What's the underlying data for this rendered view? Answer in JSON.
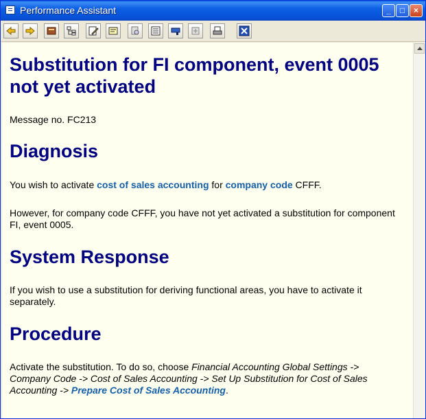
{
  "window": {
    "title": "Performance Assistant"
  },
  "toolbar": {
    "buttons": [
      "back-icon",
      "forward-icon",
      "book-icon",
      "structure-icon",
      "edit-icon",
      "hint-icon",
      "print-preview-icon",
      "document-icon",
      "flag-icon",
      "settings-icon",
      "printer-icon",
      "close-icon"
    ]
  },
  "doc": {
    "title_line1": "Substitution for FI component, event 0005",
    "title_line2": "not yet activated",
    "message_no": "Message no. FC213",
    "diagnosis_heading": "Diagnosis",
    "diag_p1_a": "You wish to activate ",
    "diag_p1_link1": "cost of sales accounting",
    "diag_p1_b": " for ",
    "diag_p1_link2": "company code",
    "diag_p1_c": " CFFF.",
    "diag_p2": "However, for company code CFFF, you have not yet activated a substitution for component FI, event 0005.",
    "sysresp_heading": "System Response",
    "sysresp_p": "If you wish to use a substitution for deriving functional areas, you have to activate it separately.",
    "procedure_heading": "Procedure",
    "proc_a": "Activate the substitution. To do so, choose ",
    "proc_italic": "Financial Accounting Global Settings -> Company Code -> Cost of Sales Accounting -> Set Up Substitution for Cost of Sales Accounting  -> ",
    "proc_link": "Prepare Cost of Sales Accounting",
    "proc_end": "."
  }
}
